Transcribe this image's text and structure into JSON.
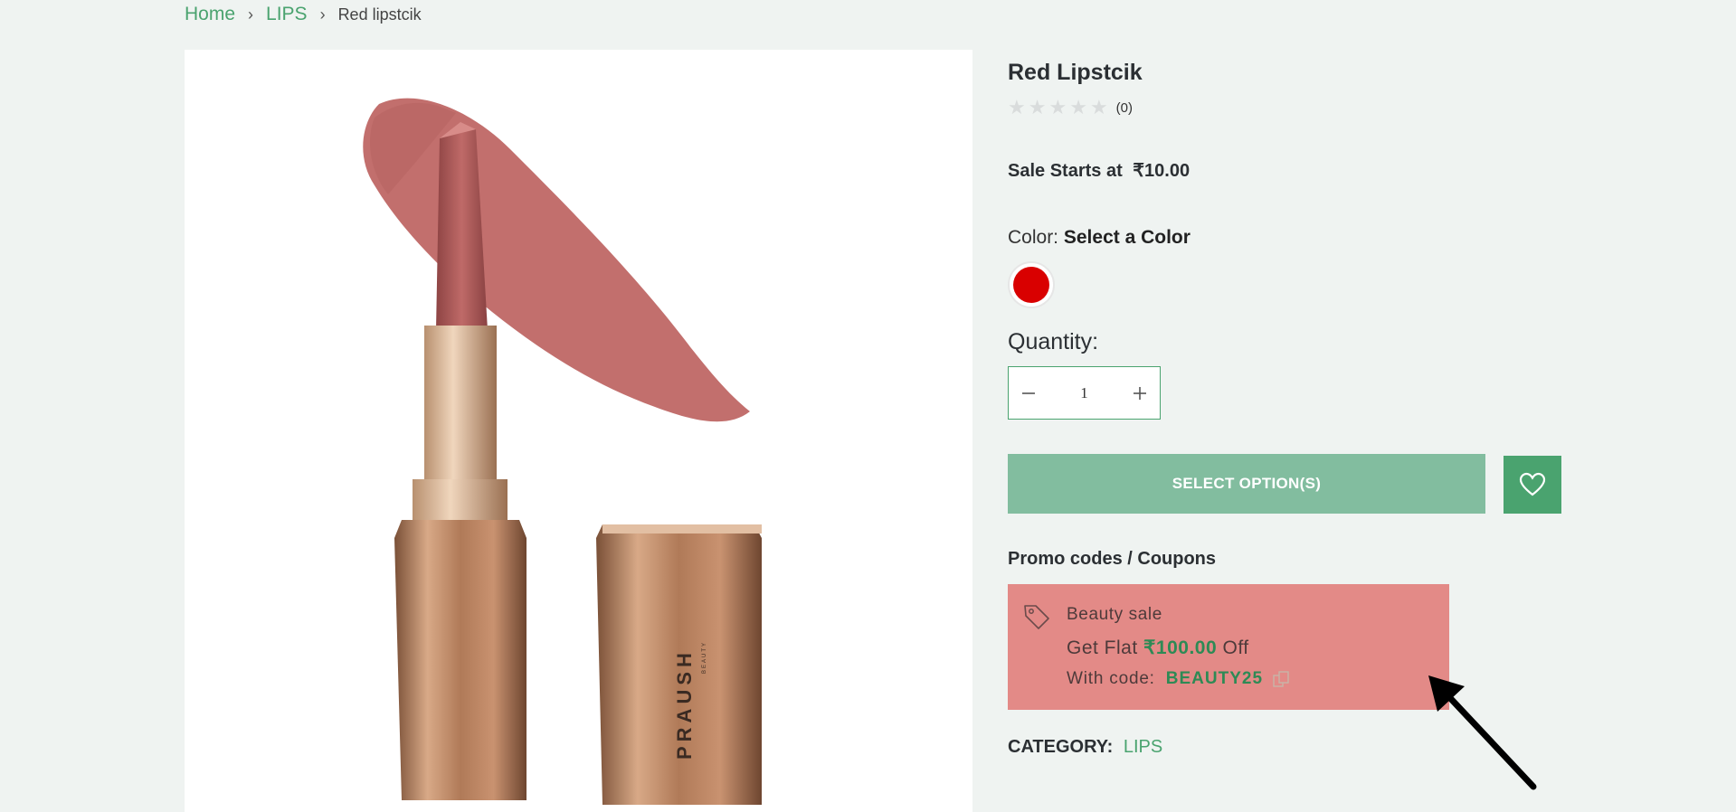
{
  "breadcrumb": {
    "items": [
      {
        "label": "Home"
      },
      {
        "label": "LIPS"
      },
      {
        "label": "Red lipstcik"
      }
    ],
    "separator": "›"
  },
  "product": {
    "title": "Red Lipstcik",
    "rating": {
      "stars": 0,
      "max": 5,
      "count_label": "(0)"
    },
    "price_label": "Sale Starts at",
    "price_value": "₹10.00",
    "color_label": "Color:",
    "color_value": "Select a Color",
    "swatches": [
      {
        "color": "#d90000"
      }
    ],
    "image": {
      "brand_text": "PRAUSH",
      "brand_sub": "BEAUTY"
    }
  },
  "quantity": {
    "label": "Quantity:",
    "value": "1",
    "minus": "−",
    "plus": "+"
  },
  "actions": {
    "select_options_label": "SELECT OPTION(S)",
    "wishlist_icon": "heart-icon"
  },
  "promo": {
    "heading": "Promo codes / Coupons",
    "coupon": {
      "title": "Beauty sale",
      "offer_prefix": "Get Flat",
      "offer_amount": "₹100.00",
      "offer_suffix": "Off",
      "code_label": "With code:",
      "code": "BEAUTY25"
    }
  },
  "category": {
    "label": "CATEGORY:",
    "value": "LIPS"
  },
  "colors": {
    "accent": "#4aa36f",
    "button": "#82bd9f",
    "coupon_bg": "#e38a87",
    "background": "#eff3f1"
  }
}
